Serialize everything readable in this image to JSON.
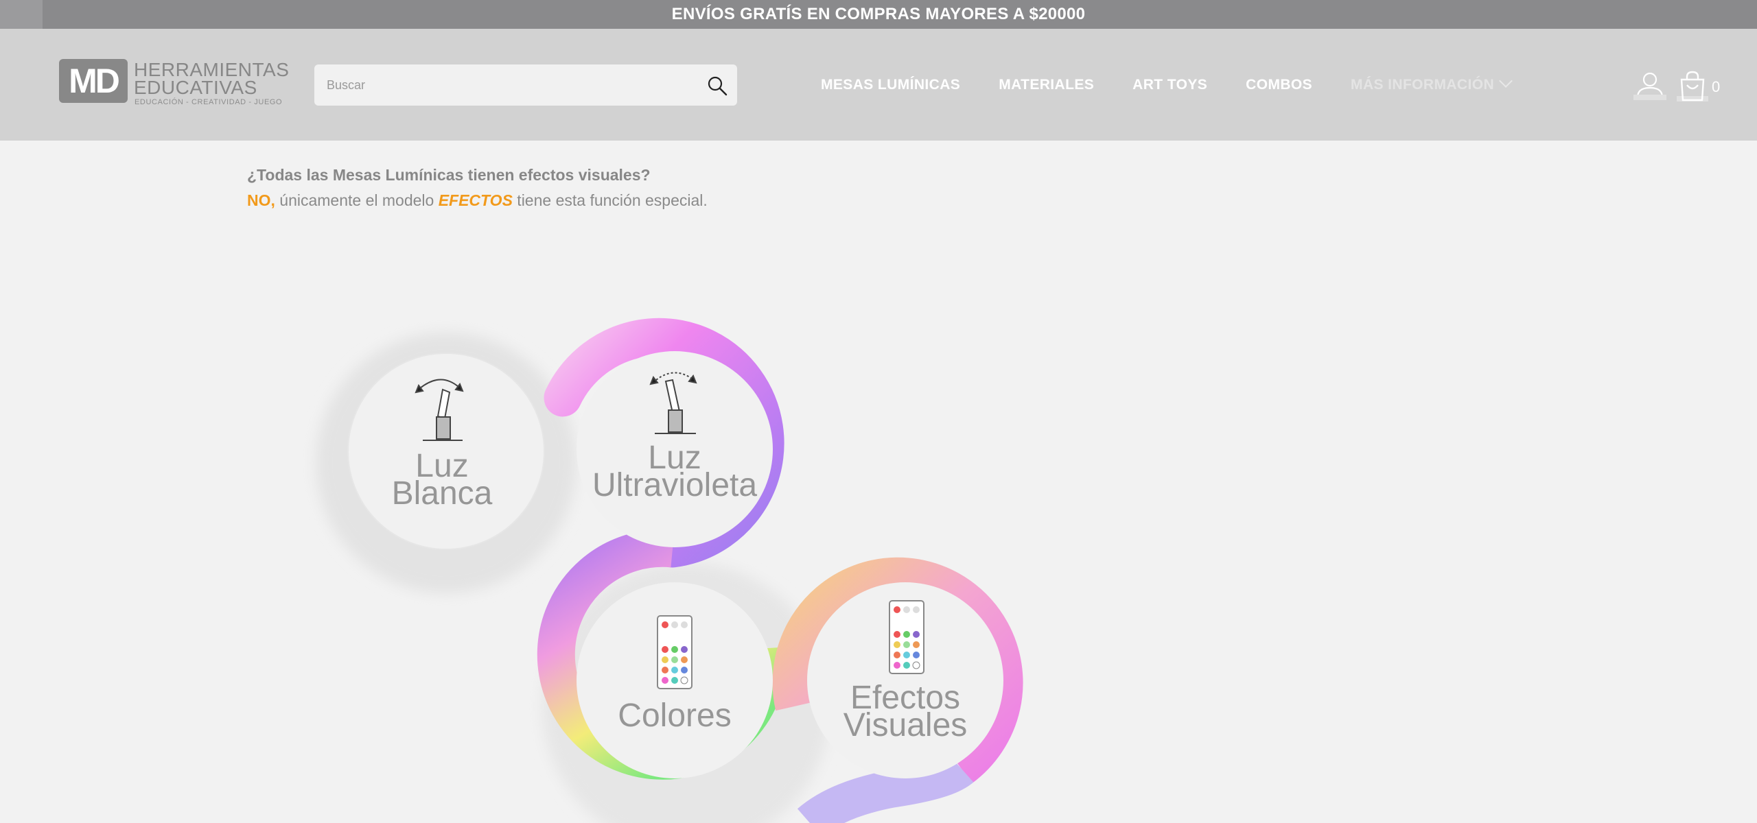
{
  "promo_bar": {
    "text": "ENVÍOS GRATÍS EN COMPRAS MAYORES A $20000"
  },
  "logo": {
    "mark": "MD",
    "line1": "HERRAMIENTAS",
    "line2": "EDUCATIVAS",
    "tagline": "EDUCACIÓN - CREATIVIDAD - JUEGO"
  },
  "search": {
    "placeholder": "Buscar",
    "value": ""
  },
  "nav": {
    "items": [
      {
        "label": "MESAS LUMÍNICAS"
      },
      {
        "label": "MATERIALES"
      },
      {
        "label": "ART TOYS"
      },
      {
        "label": "COMBOS"
      },
      {
        "label": "MÁS INFORMACIÓN"
      }
    ]
  },
  "cart": {
    "count": "0"
  },
  "faq": {
    "question": "¿Todas las Mesas Lumínicas tienen efectos visuales?",
    "answer_no": "NO,",
    "answer_mid": " únicamente el modelo ",
    "answer_model": "EFECTOS",
    "answer_end": " tiene esta función especial."
  },
  "features": [
    {
      "line1": "Luz",
      "line2": "Blanca",
      "icon": "toggle-switch-icon"
    },
    {
      "line1": "Luz",
      "line2": "Ultravioleta",
      "icon": "toggle-switch-icon"
    },
    {
      "line1": "Colores",
      "line2": "",
      "icon": "remote-control-icon"
    },
    {
      "line1": "Efectos",
      "line2": "Visuales",
      "icon": "remote-control-icon"
    }
  ],
  "colors": {
    "accent": "#f29a1b",
    "header_bg": "#d2d2d2",
    "promo_bg": "#8a8a8c"
  }
}
